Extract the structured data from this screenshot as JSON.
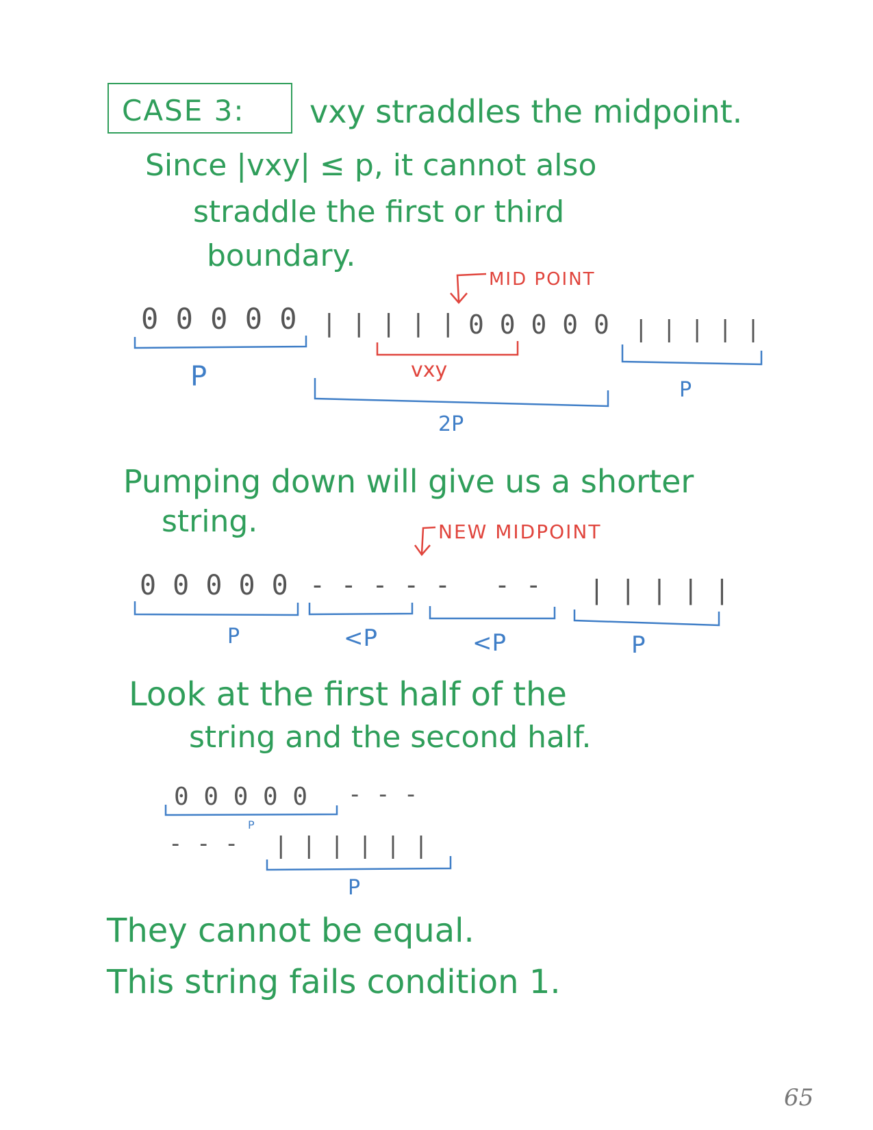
{
  "case_box": {
    "label": "CASE 3:"
  },
  "intro": {
    "line1": "vxy straddles the midpoint.",
    "line2": "Since |vxy| ≤ p, it cannot also",
    "line3": "straddle the first or third",
    "line4": "boundary."
  },
  "diagram1": {
    "midpoint_label": "MID POINT",
    "zeros_a": "0 0 0 0 0",
    "ones_a": "| | | | |",
    "zeros_b": "0 0 0 0 0",
    "ones_b": "| | | | |",
    "vxy_label": "vxy",
    "p_left": "P",
    "p_right": "P",
    "two_p": "2P"
  },
  "pump_text": {
    "line1": "Pumping down will give us a shorter",
    "line2": "string."
  },
  "diagram2": {
    "new_midpoint_label": "NEW MIDPOINT",
    "zeros": "0 0 0 0 0",
    "dashes_a": "- - - - -",
    "dashes_b": "- -",
    "ones": "| | | | |",
    "label_p1": "P",
    "label_lt1": "<P",
    "label_lt2": "<P",
    "label_p2": "P"
  },
  "look_text": {
    "line1": "Look at the first half of the",
    "line2": "string and the second half."
  },
  "diagram3": {
    "row1_zeros": "0 0 0 0 0",
    "row1_dashes": "- - -",
    "row1_label": "P",
    "row2_dashes": "- - -",
    "row2_ones": "| | | | | |",
    "row2_label": "P"
  },
  "conclusion": {
    "line1": "They cannot be equal.",
    "line2": "This string fails condition 1."
  },
  "page_number": "65",
  "colors": {
    "green": "#2f9e5a",
    "red": "#e0443c",
    "blue": "#3f7ec7",
    "ink": "#555555"
  }
}
